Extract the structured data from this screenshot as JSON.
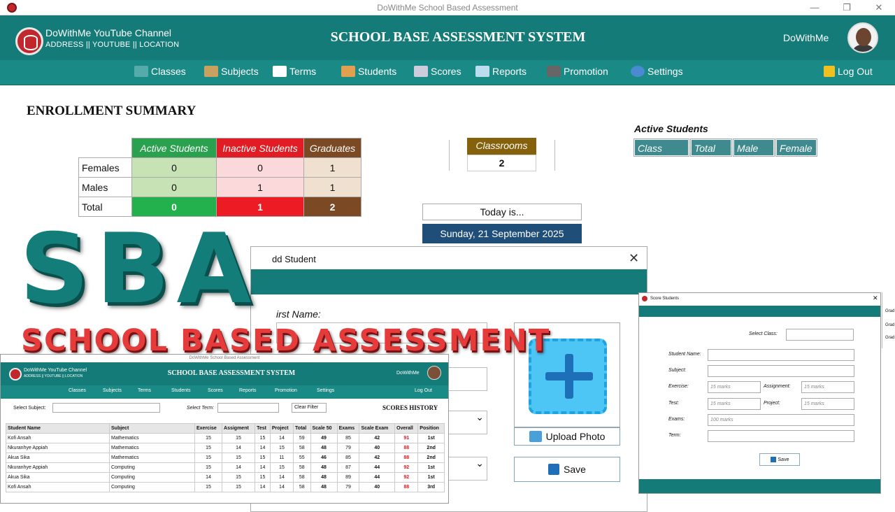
{
  "window": {
    "title": "DoWithMe School Based Assessment"
  },
  "header": {
    "channel_name": "DoWithMe YouTube Channel",
    "channel_info": "ADDRESS || YOUTUBE || LOCATION",
    "system_title": "SCHOOL BASE ASSESSMENT SYSTEM",
    "user_name": "DoWithMe"
  },
  "nav": {
    "items": [
      {
        "label": "Classes",
        "icon": "classes-icon"
      },
      {
        "label": "Subjects",
        "icon": "books-icon"
      },
      {
        "label": "Terms",
        "icon": "open-book-icon"
      },
      {
        "label": "Students",
        "icon": "student-icon"
      },
      {
        "label": "Scores",
        "icon": "scores-icon"
      },
      {
        "label": "Reports",
        "icon": "reports-icon"
      },
      {
        "label": "Promotion",
        "icon": "graduation-cap-icon"
      },
      {
        "label": "Settings",
        "icon": "gear-icon"
      }
    ],
    "logout": "Log Out"
  },
  "summary": {
    "title": "ENROLLMENT SUMMARY",
    "columns": [
      "Active Students",
      "Inactive Students",
      "Graduates"
    ],
    "rows": [
      {
        "label": "Females",
        "values": [
          "0",
          "0",
          "1"
        ]
      },
      {
        "label": "Males",
        "values": [
          "0",
          "1",
          "1"
        ]
      },
      {
        "label": "Total",
        "values": [
          "0",
          "1",
          "2"
        ]
      }
    ]
  },
  "classrooms": {
    "label": "Classrooms",
    "value": "2"
  },
  "today": {
    "label": "Today is...",
    "date": "Sunday, 21 September 2025"
  },
  "active_students": {
    "title": "Active Students",
    "columns": [
      "Class",
      "Total",
      "Male",
      "Female"
    ]
  },
  "overlay": {
    "big": "SBA",
    "sub": "SCHOOL BASED ASSESSMENT"
  },
  "add_student": {
    "title": "dd Student",
    "first_name_label": "irst Name:",
    "upload_label": "Upload Photo",
    "save_label": "Save"
  },
  "scores_history": {
    "window_title": "DoWithMe School Based Assessment",
    "channel_name": "DoWithMe YouTube Channel",
    "channel_info": "ADDRESS || YOUTUBE || LOCATION",
    "system_title": "SCHOOL BASE ASSESSMENT SYSTEM",
    "user_name": "DoWithMe",
    "nav": [
      "Classes",
      "Subjects",
      "Terms",
      "Students",
      "Scores",
      "Reports",
      "Promotion",
      "Settings"
    ],
    "logout": "Log Out",
    "select_subject_label": "Select Subject:",
    "select_term_label": "Select Term:",
    "clear_filter": "Clear Filter",
    "title": "SCORES HISTORY",
    "columns": [
      "Student Name",
      "Subject",
      "Exercise",
      "Assigment",
      "Test",
      "Project",
      "Total",
      "Scale 50",
      "Exams",
      "Scale Exam",
      "Overall",
      "Position"
    ],
    "rows": [
      [
        "Kofi Ansah",
        "Mathematics",
        "15",
        "15",
        "15",
        "14",
        "59",
        "49",
        "85",
        "42",
        "91",
        "1st"
      ],
      [
        "Nkuranhye Appiah",
        "Mathematics",
        "15",
        "14",
        "14",
        "15",
        "58",
        "48",
        "79",
        "40",
        "88",
        "2nd"
      ],
      [
        "Akua Sika",
        "Mathematics",
        "15",
        "15",
        "15",
        "11",
        "55",
        "46",
        "85",
        "42",
        "88",
        "2nd"
      ],
      [
        "Nkuranhye Appiah",
        "Computing",
        "15",
        "14",
        "14",
        "15",
        "58",
        "48",
        "87",
        "44",
        "92",
        "1st"
      ],
      [
        "Akua Sika",
        "Computing",
        "14",
        "15",
        "15",
        "14",
        "58",
        "48",
        "89",
        "44",
        "92",
        "1st"
      ],
      [
        "Kofi Ansah",
        "Computing",
        "15",
        "15",
        "14",
        "14",
        "58",
        "48",
        "79",
        "40",
        "88",
        "3rd"
      ]
    ]
  },
  "score_students": {
    "title": "Score Students",
    "select_class": "Select Class:",
    "student_name": "Student Name:",
    "subject": "Subject:",
    "exercise": "Exercise:",
    "exercise_placeholder": "15 marks",
    "assignment": "Assignment:",
    "assignment_placeholder": "15 marks",
    "test": "Test:",
    "test_placeholder": "15 marks",
    "project": "Project:",
    "project_placeholder": "15 marks",
    "exams": "Exams:",
    "exams_placeholder": "100 marks",
    "term": "Term:",
    "save": "Save",
    "edge_labels": [
      "Grad",
      "Grad",
      "Grad"
    ]
  },
  "colors": {
    "teal": "#147b78",
    "active": "#22b14c",
    "inactive": "#ed1c24",
    "graduates": "#7b4a24",
    "classrooms": "#86610b",
    "date": "#1f4e79"
  }
}
